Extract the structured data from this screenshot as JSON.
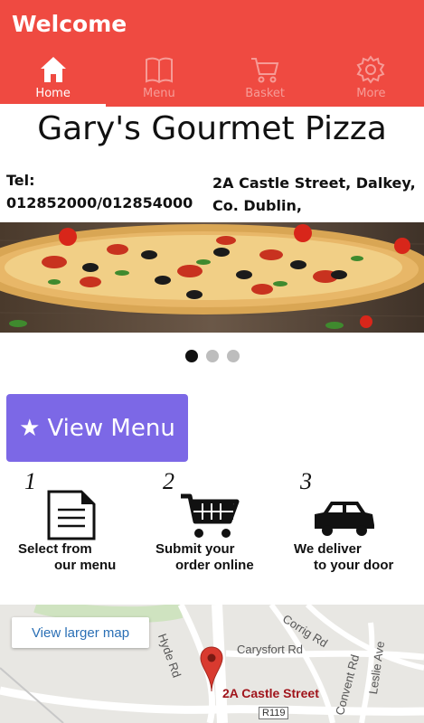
{
  "app": {
    "title": "Welcome"
  },
  "tabs": [
    {
      "label": "Home",
      "icon": "home-icon",
      "active": true
    },
    {
      "label": "Menu",
      "icon": "book-icon",
      "active": false
    },
    {
      "label": "Basket",
      "icon": "cart-icon",
      "active": false
    },
    {
      "label": "More",
      "icon": "gear-icon",
      "active": false
    }
  ],
  "shop": {
    "name": "Gary's Gourmet Pizza",
    "tel_label": "Tel:",
    "tel_value": "012852000/012854000",
    "address": "2A Castle Street, Dalkey, Co. Dublin,"
  },
  "carousel": {
    "count": 3,
    "active_index": 0
  },
  "view_menu": {
    "label": "View Menu",
    "icon": "star-icon"
  },
  "steps": [
    {
      "number": "1",
      "line1": "Select from",
      "line2": "our menu",
      "icon": "document-icon"
    },
    {
      "number": "2",
      "line1": "Submit your",
      "line2": "order online",
      "icon": "cart-icon"
    },
    {
      "number": "3",
      "line1": "We deliver",
      "line2": "to your door",
      "icon": "car-icon"
    }
  ],
  "map": {
    "larger_map_label": "View larger map",
    "pin_label": "2A Castle Street",
    "streets": [
      "Hyde Rd",
      "Corrig Rd",
      "Carysfort Rd",
      "Convent Rd",
      "Leslie Ave"
    ],
    "road_badge": "R119"
  },
  "colors": {
    "header": "#ef4a41",
    "button": "#7c68e6",
    "pin": "#d93a2f"
  }
}
